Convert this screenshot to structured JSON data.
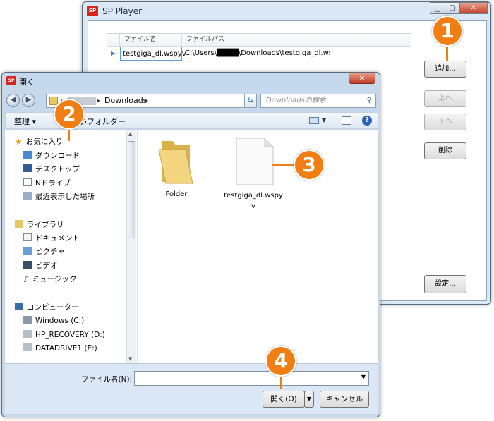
{
  "sp_player": {
    "logo": "SP",
    "title": "SP Player",
    "table": {
      "headers": [
        "ファイル名",
        "ファイルパス"
      ],
      "rows": [
        {
          "name": "testgiga_dl.wspyv",
          "path": "C:\\Users\\████\\Downloads\\testgiga_dl.wspyv"
        }
      ]
    },
    "buttons": {
      "add": "追加...",
      "up": "上へ",
      "down": "下へ",
      "delete": "削除",
      "settings": "設定..."
    }
  },
  "open_dialog": {
    "logo": "SP",
    "title": "開く",
    "close": "×",
    "address": {
      "path_segments": [
        "Downloads"
      ]
    },
    "search_placeholder": "Downloadsの検索",
    "toolbar": {
      "organize": "整理 ▾",
      "new_folder": "新しいフォルダー"
    },
    "nav": {
      "favorites": {
        "label": "お気に入り",
        "items": [
          "ダウンロード",
          "デスクトップ",
          "Nドライブ",
          "最近表示した場所"
        ]
      },
      "libraries": {
        "label": "ライブラリ",
        "items": [
          "ドキュメント",
          "ピクチャ",
          "ビデオ",
          "ミュージック"
        ]
      },
      "computer": {
        "label": "コンピューター",
        "items": [
          "Windows (C:)",
          "HP_RECOVERY (D:)",
          "DATADRIVE1 (E:)"
        ]
      }
    },
    "files": [
      {
        "name": "Folder",
        "type": "folder"
      },
      {
        "name": "testgiga_dl.wspyv",
        "type": "file"
      }
    ],
    "filename_label": "ファイル名(N):",
    "filename_value": "",
    "open_button": "開く(O)",
    "cancel_button": "キャンセル"
  },
  "callouts": [
    "1",
    "2",
    "3",
    "4"
  ],
  "colors": {
    "callout": "#f07e12",
    "selection": "#cfe3f8",
    "title_bar": "#dbe8f5"
  }
}
